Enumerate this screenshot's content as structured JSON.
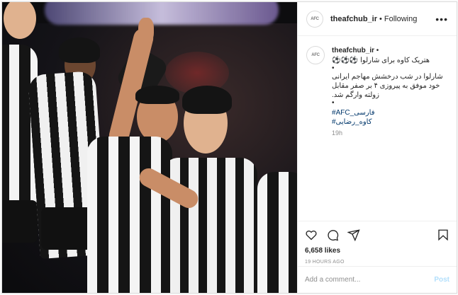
{
  "photo": {
    "alt_subject": "post-photo"
  },
  "header": {
    "username": "theafchub_ir",
    "separator": "•",
    "follow_status": "Following",
    "more_icon": "more-horizontal-icon",
    "avatar_text": "AFC"
  },
  "caption": {
    "username": "theafchub_ir",
    "username_dot": "•",
    "title": "هتریک کاوه برای شارلوا ⚽⚽⚽",
    "bullet1": "•",
    "body": "شارلوا در شب درخشش مهاجم ایرانی خود موفق به پیروزی ۴ بر صفر مقابل زولته وارگم شد.",
    "bullet2": "•",
    "tags": [
      "فارسی_AFC#",
      "کاوه_رضایی#"
    ],
    "time": "19h"
  },
  "actions": {
    "like_icon": "heart-icon",
    "comment_icon": "comment-bubble-icon",
    "share_icon": "paper-plane-icon",
    "save_icon": "bookmark-icon",
    "likes": "6,658 likes",
    "posted_ago": "19 HOURS AGO"
  },
  "comment_box": {
    "placeholder": "Add a comment...",
    "post_label": "Post"
  },
  "colors": {
    "link": "#00376b",
    "post_button_disabled": "#b2dffc",
    "muted": "#8e8e8e"
  }
}
